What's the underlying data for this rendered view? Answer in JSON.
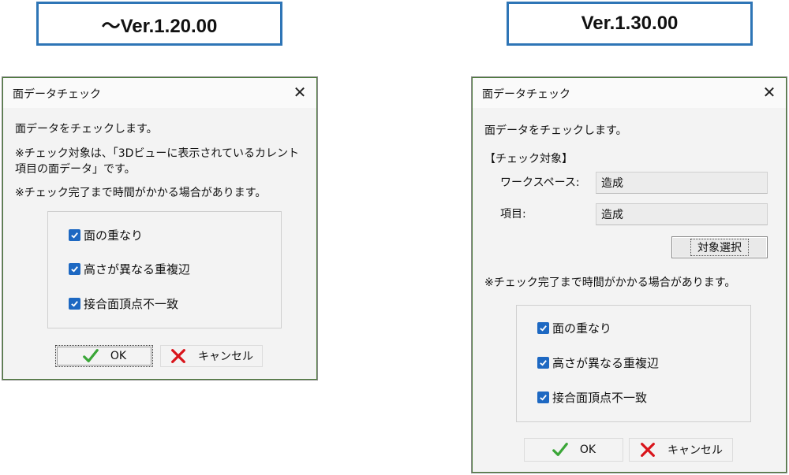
{
  "versions": {
    "old": "～Ver.1.20.00",
    "new": "Ver.1.30.00"
  },
  "dialog_old": {
    "title": "面データチェック",
    "close": "✕",
    "line1": "面データをチェックします。",
    "line2": "※チェック対象は、「3Dビューに表示されているカレント",
    "line3": "項目の面データ」です。",
    "line4": "※チェック完了まで時間がかかる場合があります。",
    "checkboxes": [
      "面の重なり",
      "高さが異なる重複辺",
      "接合面頂点不一致"
    ],
    "ok": "OK",
    "cancel": "キャンセル"
  },
  "dialog_new": {
    "title": "面データチェック",
    "close": "✕",
    "line1": "面データをチェックします。",
    "section": "【チェック対象】",
    "workspace_label": "ワークスペース:",
    "workspace_value": "造成",
    "item_label": "項目:",
    "item_value": "造成",
    "select_button": "対象選択",
    "note": "※チェック完了まで時間がかかる場合があります。",
    "checkboxes": [
      "面の重なり",
      "高さが異なる重複辺",
      "接合面頂点不一致"
    ],
    "ok": "OK",
    "cancel": "キャンセル"
  },
  "colors": {
    "checkbox": "#1d68c2",
    "ok_check": "#3aa637",
    "cancel_x": "#d9141b",
    "version_border": "#2e75b6"
  }
}
